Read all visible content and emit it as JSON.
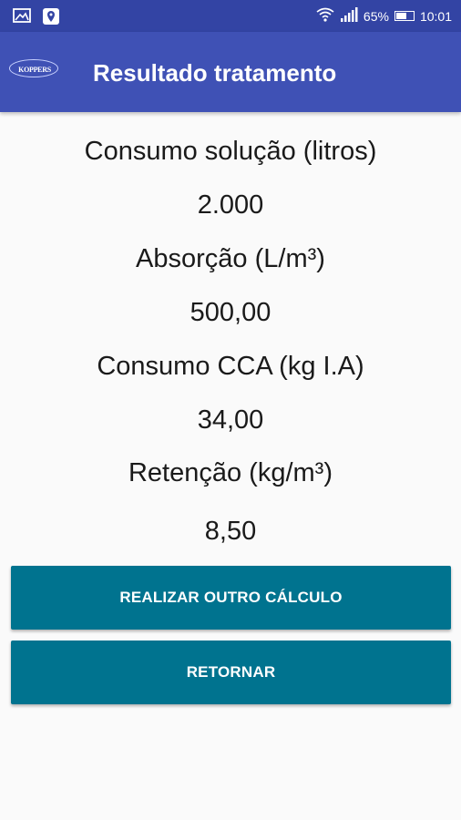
{
  "status_bar": {
    "battery": "65%",
    "battery_level": 0.65,
    "time": "10:01",
    "icons": [
      "image-icon",
      "location-notification-icon",
      "wifi-icon",
      "signal-icon",
      "battery-icon"
    ]
  },
  "app_bar": {
    "logo_text": "KOPPERS",
    "title": "Resultado tratamento"
  },
  "results": [
    {
      "label": "Consumo solução (litros)",
      "value": "2.000"
    },
    {
      "label": "Absorção (L/m³)",
      "value": "500,00"
    },
    {
      "label": "Consumo CCA (kg I.A)",
      "value": "34,00"
    },
    {
      "label": "Retenção (kg/m³)",
      "value": "8,50"
    }
  ],
  "buttons": {
    "recalculate": "REALIZAR OUTRO CÁLCULO",
    "back": "RETORNAR"
  },
  "colors": {
    "status_bar": "#3344a4",
    "app_bar": "#3f51b5",
    "button": "#00738f",
    "background": "#fafafa"
  }
}
